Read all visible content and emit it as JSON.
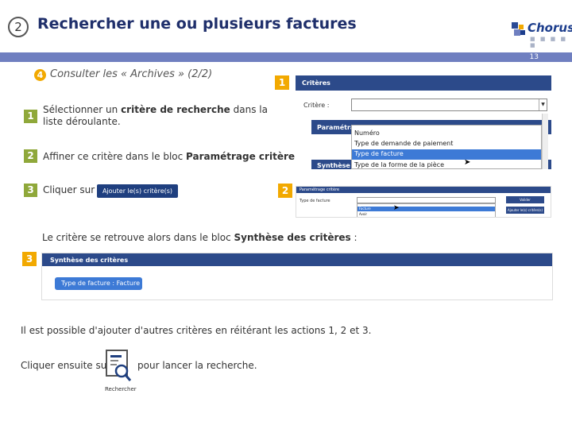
{
  "header": {
    "step_number": "2",
    "title": "Rechercher une ou plusieurs factures",
    "logo_text": "Chorus",
    "page_number": "13"
  },
  "section": {
    "badge": "4",
    "subtitle": "Consulter les « Archives » (2/2)"
  },
  "steps": [
    {
      "number": "1",
      "text_before": "Sélectionner un ",
      "bold": "critère de recherche",
      "text_after": " dans la liste déroulante."
    },
    {
      "number": "2",
      "text_before": "Affiner ce critère dans le bloc ",
      "bold": "Paramétrage  critère",
      "text_after": "."
    },
    {
      "number": "3",
      "text_before": "Cliquer sur",
      "button_label": "Ajouter le(s) critère(s)"
    }
  ],
  "result_text": {
    "before": "Le critère se retrouve alors dans le bloc ",
    "bold": "Synthèse des critères",
    "after": " :"
  },
  "screenshot1": {
    "badge": "1",
    "bar_title": "Critères",
    "field_label": "Critère :",
    "bar2_title": "Paramétrag",
    "bar3_title": "Synthèse d",
    "options": [
      "Numéro",
      "Type de demande de paiement",
      "Type de facture",
      "Type de la forme de la pièce"
    ],
    "selected_option": "Type de facture"
  },
  "screenshot2": {
    "badge": "2",
    "bar_title": "Paramétrage critère",
    "field_label": "Type de facture",
    "options": [
      "Facture",
      "Avoir"
    ],
    "button1": "Valider",
    "button2": "Ajouter le(s) critère(s)"
  },
  "screenshot3": {
    "badge": "3",
    "bar_title": "Synthèse des critères",
    "chip_label": "Type de facture : Facture",
    "chip_close": "x"
  },
  "footer": {
    "repeat_text": "Il est possible d'ajouter d'autres critères en réitérant les actions 1, 2 et 3.",
    "search_before": "Cliquer ensuite sur",
    "search_after": "pour lancer la recherche.",
    "search_caption": "Rechercher"
  },
  "colors": {
    "title": "#1f2f6b",
    "header_bar": "#6f7fc0",
    "step_badge": "#8fa83a",
    "screenshot_badge": "#f2a900",
    "app_bar": "#2c4a8a",
    "selection": "#3d7ad6"
  }
}
